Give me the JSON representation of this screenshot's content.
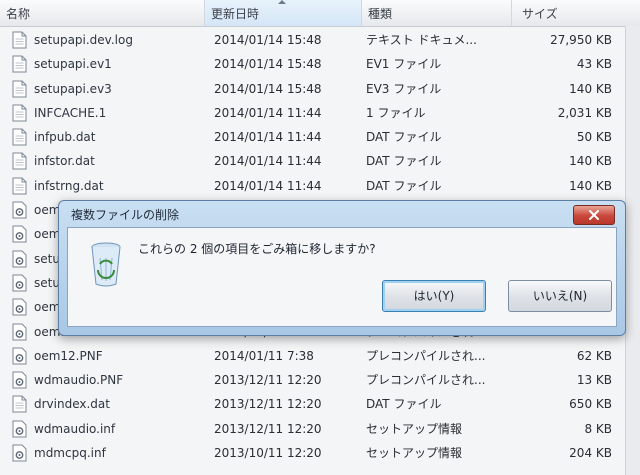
{
  "columns": {
    "name": "名称",
    "date": "更新日時",
    "type": "種類",
    "size": "サイズ"
  },
  "files": [
    {
      "name": "setupapi.dev.log",
      "date": "2014/01/14 15:48",
      "type": "テキスト ドキュメ...",
      "size": "27,950 KB"
    },
    {
      "name": "setupapi.ev1",
      "date": "2014/01/14 15:48",
      "type": "EV1 ファイル",
      "size": "43 KB"
    },
    {
      "name": "setupapi.ev3",
      "date": "2014/01/14 15:48",
      "type": "EV3 ファイル",
      "size": "140 KB"
    },
    {
      "name": "INFCACHE.1",
      "date": "2014/01/14 11:44",
      "type": "1 ファイル",
      "size": "2,031 KB"
    },
    {
      "name": "infpub.dat",
      "date": "2014/01/14 11:44",
      "type": "DAT ファイル",
      "size": "50 KB"
    },
    {
      "name": "infstor.dat",
      "date": "2014/01/14 11:44",
      "type": "DAT ファイル",
      "size": "140 KB"
    },
    {
      "name": "infstrng.dat",
      "date": "2014/01/14 11:44",
      "type": "DAT ファイル",
      "size": "140 KB"
    },
    {
      "name": "oem",
      "date": "",
      "type": "",
      "size": ""
    },
    {
      "name": "oem",
      "date": "",
      "type": "",
      "size": ""
    },
    {
      "name": "setu",
      "date": "",
      "type": "",
      "size": ""
    },
    {
      "name": "setu",
      "date": "",
      "type": "",
      "size": ""
    },
    {
      "name": "oem",
      "date": "",
      "type": "",
      "size": ""
    },
    {
      "name": "oem14.PNF",
      "date": "2014/01/11 7:39",
      "type": "プレコンパイルされ...",
      "size": "12 KB"
    },
    {
      "name": "oem12.PNF",
      "date": "2014/01/11 7:38",
      "type": "プレコンパイルされ...",
      "size": "62 KB"
    },
    {
      "name": "wdmaudio.PNF",
      "date": "2013/12/11 12:20",
      "type": "プレコンパイルされ...",
      "size": "13 KB"
    },
    {
      "name": "drvindex.dat",
      "date": "2013/12/11 12:20",
      "type": "DAT ファイル",
      "size": "650 KB"
    },
    {
      "name": "wdmaudio.inf",
      "date": "2013/12/11 12:20",
      "type": "セットアップ情報",
      "size": "8 KB"
    },
    {
      "name": "mdmcpq.inf",
      "date": "2013/10/11 12:20",
      "type": "セットアップ情報",
      "size": "204 KB"
    }
  ],
  "dialog": {
    "title": "複数ファイルの削除",
    "message": "これらの 2 個の項目をごみ箱に移しますか?",
    "yes_label": "はい(Y)",
    "no_label": "いいえ(N)",
    "close_icon": "close-icon",
    "icon": "recycle-bin-icon"
  },
  "colors": {
    "dialog_frame": "#a9c8e6",
    "close_button": "#c8463a",
    "default_button_glow": "#9fd2f2"
  }
}
